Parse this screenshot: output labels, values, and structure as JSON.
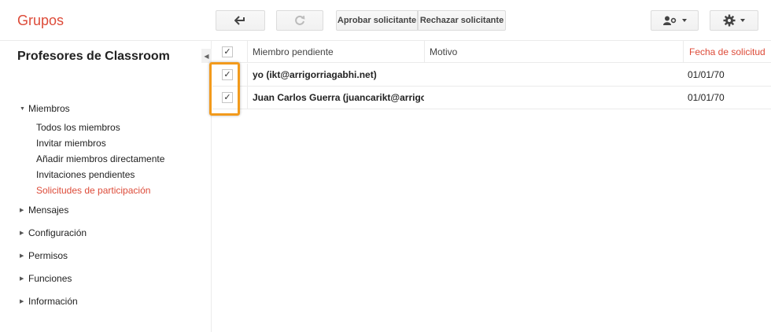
{
  "app": {
    "title": "Grupos"
  },
  "toolbar": {
    "back_icon": "back-arrow-icon",
    "refresh_icon": "refresh-icon",
    "approve_label": "Aprobar solicitante",
    "reject_label": "Rechazar solicitante",
    "user_icon": "user-settings-icon",
    "gear_icon": "gear-icon"
  },
  "sidebar": {
    "group_name": "Profesores de Classroom",
    "sections": [
      {
        "label": "Miembros",
        "expanded": true
      },
      {
        "label": "Mensajes",
        "expanded": false
      },
      {
        "label": "Configuración",
        "expanded": false
      },
      {
        "label": "Permisos",
        "expanded": false
      },
      {
        "label": "Funciones",
        "expanded": false
      },
      {
        "label": "Información",
        "expanded": false
      }
    ],
    "members_items": [
      {
        "label": "Todos los miembros"
      },
      {
        "label": "Invitar miembros"
      },
      {
        "label": "Añadir miembros directamente"
      },
      {
        "label": "Invitaciones pendientes"
      },
      {
        "label": "Solicitudes de participación",
        "active": true
      }
    ]
  },
  "table": {
    "headers": {
      "member": "Miembro pendiente",
      "reason": "Motivo",
      "date": "Fecha de solicitud"
    },
    "rows": [
      {
        "member": "yo (ikt@arrigorriagabhi.net)",
        "reason": "",
        "date": "01/01/70",
        "checked": true
      },
      {
        "member": "Juan Carlos Guerra (juancarikt@arrigorriagabhi.net)",
        "reason": "",
        "date": "01/01/70",
        "checked": true
      }
    ]
  },
  "colors": {
    "accent": "#dd4b39",
    "highlight": "#f29a1c"
  }
}
